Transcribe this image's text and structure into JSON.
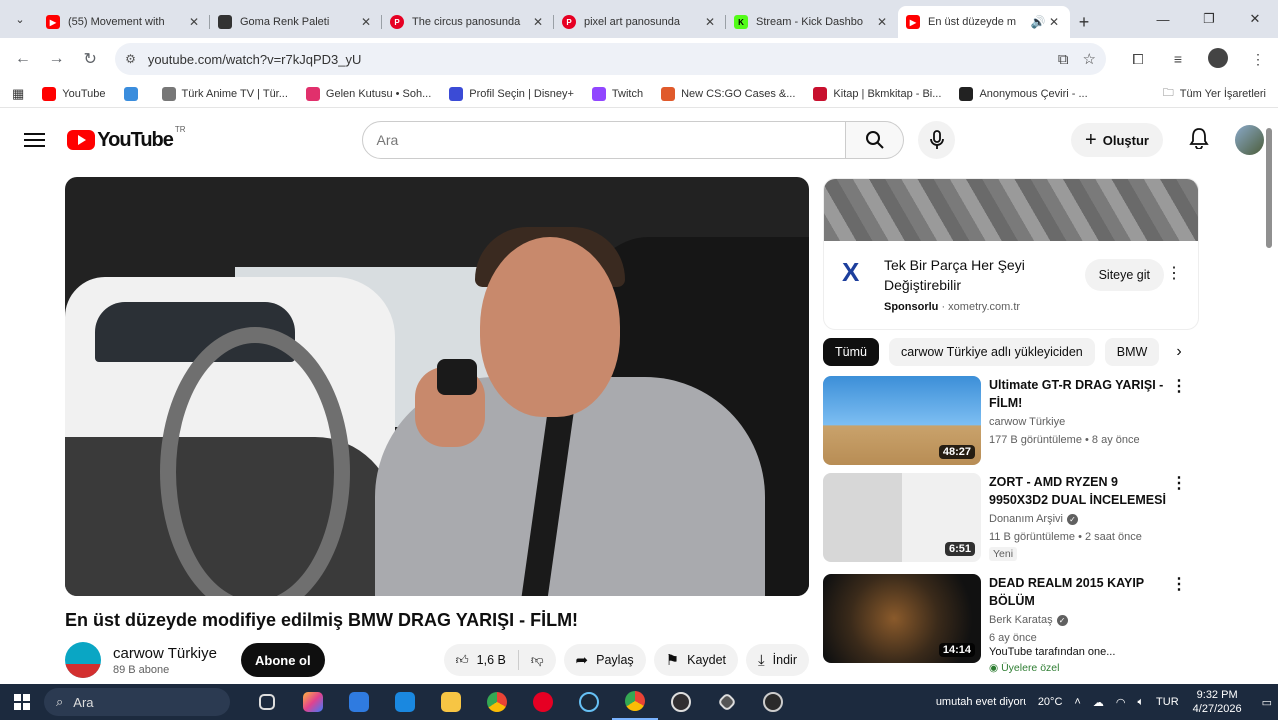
{
  "browser": {
    "tabs": [
      {
        "title": "(55) Movement with",
        "color": "#ff0000",
        "active": false
      },
      {
        "title": "Goma Renk Paleti",
        "color": "#333333",
        "active": false
      },
      {
        "title": "The circus panosunda",
        "color": "#e60023",
        "active": false
      },
      {
        "title": "pixel art panosunda",
        "color": "#e60023",
        "active": false
      },
      {
        "title": "Stream - Kick Dashbo",
        "color": "#53fc18",
        "active": false
      },
      {
        "title": "En üst düzeyde m",
        "color": "#ff0000",
        "active": true
      }
    ],
    "url": "youtube.com/watch?v=r7kJqPD3_yU",
    "bookmarks": [
      {
        "label": "YouTube",
        "color": "#ff0000"
      },
      {
        "label": "",
        "color": "#3a8ddd"
      },
      {
        "label": "Türk Anime TV | Tür...",
        "color": "#777777"
      },
      {
        "label": "Gelen Kutusu • Soh...",
        "color": "#e1306c"
      },
      {
        "label": "Profil Seçin | Disney+",
        "color": "#3b4bd6"
      },
      {
        "label": "Twitch",
        "color": "#9146ff"
      },
      {
        "label": "New CS:GO Cases &...",
        "color": "#e05a2b"
      },
      {
        "label": "Kitap | Bkmkitap - Bi...",
        "color": "#c8102e"
      },
      {
        "label": "Anonymous Çeviri - ...",
        "color": "#222222"
      }
    ],
    "all_bookmarks": "Tüm Yer İşaretleri"
  },
  "youtube": {
    "logo_text": "YouTube",
    "country": "TR",
    "search_placeholder": "Ara",
    "create_label": "Oluştur"
  },
  "video": {
    "title": "En üst düzeyde modifiye edilmiş BMW DRAG YARIŞI - FİLM!",
    "channel": "carwow Türkiye",
    "subscribers": "89 B abone",
    "subscribe_label": "Abone ol",
    "likes": "1,6 B",
    "share_label": "Paylaş",
    "save_label": "Kaydet",
    "download_label": "İndir"
  },
  "ad": {
    "headline": "Tek Bir Parça Her Şeyi Değiştirebilir",
    "sponsored": "Sponsorlu",
    "domain": "xometry.com.tr",
    "cta": "Siteye git"
  },
  "chips": [
    "Tümü",
    "carwow Türkiye adlı yükleyiciden",
    "BMW"
  ],
  "recommendations": [
    {
      "title": "Ultimate GT-R DRAG YARIŞI - FİLM!",
      "channel": "carwow Türkiye",
      "stats": "177 B görüntüleme • 8 ay önce",
      "duration": "48:27",
      "badge": "",
      "thumb_color": "#3c8fd8"
    },
    {
      "title": "ZORT - AMD RYZEN 9 9950X3D2 DUAL İNCELEMESİ",
      "channel": "Donanım Arşivi",
      "stats": "11 B görüntüleme • 2 saat önce",
      "duration": "6:51",
      "badge": "Yeni",
      "thumb_color": "#c9c9c9"
    },
    {
      "title": "DEAD REALM 2015 KAYIP BÖLÜM",
      "channel": "Berk Karataş",
      "stats": "6 ay önce",
      "duration": "14:14",
      "badge": "YouTube tarafından one...",
      "badge2": "Üyelere özel",
      "thumb_color": "#2b231a"
    }
  ],
  "taskbar": {
    "search": "Ara",
    "weather": "20°C",
    "lang": "TUR",
    "time": "9:32 PM",
    "date": "4/27/2026",
    "media": "umutah evet diyorum",
    "icons": [
      "task-view",
      "copilot",
      "store",
      "mail",
      "file-explorer",
      "chrome",
      "pinterest",
      "steam",
      "chrome-active",
      "obs",
      "unity",
      "app"
    ]
  }
}
